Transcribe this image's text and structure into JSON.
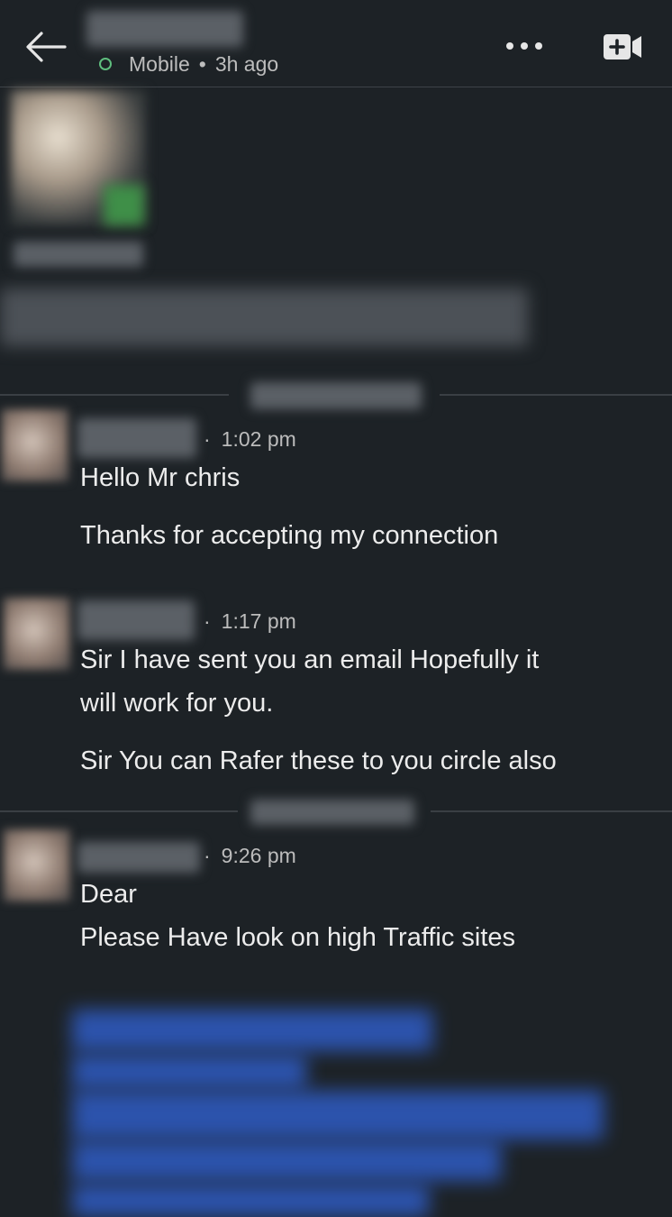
{
  "header": {
    "status": "Mobile",
    "separator": "•",
    "last_active": "3h ago"
  },
  "messages": [
    {
      "time": "1:02 pm",
      "lines": [
        "Hello Mr chris",
        "Thanks for accepting my connection"
      ]
    },
    {
      "time": "1:17 pm",
      "lines": [
        "Sir I have sent you an email Hopefully it",
        "will work for you.",
        "Sir You can Rafer these to you circle also"
      ]
    },
    {
      "time": "9:26 pm",
      "lines": [
        "Dear",
        "Please Have look on high Traffic sites"
      ]
    }
  ],
  "colors": {
    "background": "#1d2226",
    "online_status": "#5fbe7e",
    "link_text": "#2f5cc4"
  },
  "icons": [
    "back-arrow-icon",
    "more-options-icon",
    "video-call-icon"
  ]
}
